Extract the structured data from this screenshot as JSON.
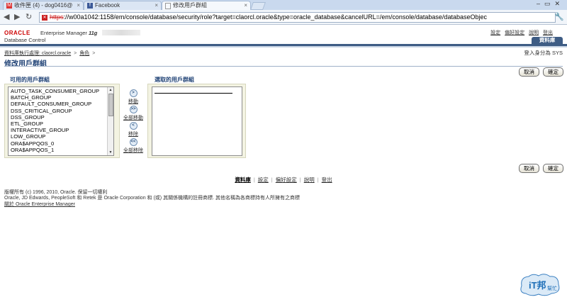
{
  "browser": {
    "tabs": [
      {
        "label": "收件匣 (4) - dog0416@",
        "icon": "gmail-icon"
      },
      {
        "label": "Facebook",
        "icon": "facebook-icon"
      },
      {
        "label": "修改用戶群組",
        "icon": "page-icon"
      }
    ],
    "url_scheme": "https",
    "url_rest": "://w00a1042:1158/em/console/database/security/role?target=claorcl.oracle&type=oracle_database&cancelURL=/em/console/database/databaseObjec"
  },
  "header": {
    "logo": "ORACLE",
    "product": "Enterprise Manager",
    "version": "11g",
    "subtitle": "Database Control",
    "global_links": [
      "設定",
      "偏好設定",
      "說明",
      "登出"
    ],
    "db_tab": "資料庫"
  },
  "breadcrumb": {
    "items": [
      "資料庫執行處理: claorcl.oracle",
      "角色"
    ],
    "separator": ">"
  },
  "login_as": "登入身分為 SYS",
  "page_title": "修改用戶群組",
  "buttons": {
    "cancel": "取消",
    "ok": "確定"
  },
  "shuttle": {
    "available_label": "可用的用戶群組",
    "selected_label": "選取的用戶群組",
    "available_items": [
      "AUTO_TASK_CONSUMER_GROUP",
      "BATCH_GROUP",
      "DEFAULT_CONSUMER_GROUP",
      "DSS_CRITICAL_GROUP",
      "DSS_GROUP",
      "ETL_GROUP",
      "INTERACTIVE_GROUP",
      "LOW_GROUP",
      "ORA$APPQOS_0",
      "ORA$APPQOS_1"
    ],
    "actions": [
      {
        "icon": "move-icon",
        "glyph": ">",
        "label": "移動"
      },
      {
        "icon": "move-all-icon",
        "glyph": ">>",
        "label": "全部移動"
      },
      {
        "icon": "remove-icon",
        "glyph": "<",
        "label": "移除"
      },
      {
        "icon": "remove-all-icon",
        "glyph": "<<",
        "label": "全部移除"
      }
    ]
  },
  "footer": {
    "links": [
      "資料庫",
      "設定",
      "偏好設定",
      "說明",
      "登出"
    ],
    "copyright": "版權所有 (c) 1996, 2010, Oracle. 保留一切權利",
    "trademark": "Oracle, JD Edwards, PeopleSoft 和 Retek 是 Oracle Corporation 和 (或) 其關係機構的註冊商標. 其他名稱為各商標持有人所擁有之商標",
    "about": "關於 Oracle Enterprise Manager"
  },
  "watermark": {
    "line1": "iT邦",
    "line2": "幫忙"
  },
  "colors": {
    "oracle_red": "#cc0000",
    "header_blue": "#3e5c84",
    "title_blue": "#224477",
    "shuttle_bg": "#f3f3e2"
  }
}
